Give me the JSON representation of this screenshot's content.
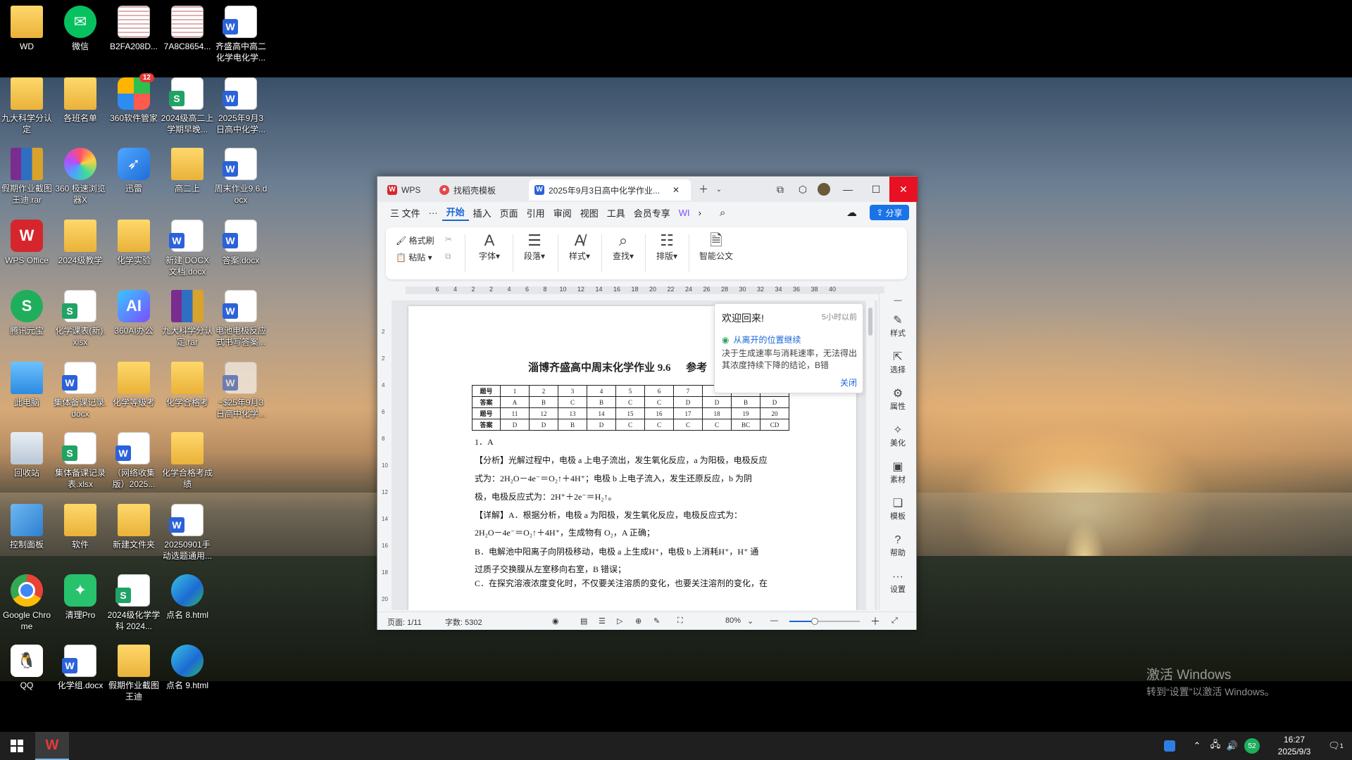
{
  "desktop": {
    "icons": [
      {
        "label": "WD"
      },
      {
        "label": "微信"
      },
      {
        "label": "B2FA208D..."
      },
      {
        "label": "7A8C8654..."
      },
      {
        "label": "齐盛高中高二化学电化学..."
      },
      {
        "label": "九大科学分认定"
      },
      {
        "label": "各班名单"
      },
      {
        "label": "360软件管家"
      },
      {
        "label": "2024级高二上学期早晚..."
      },
      {
        "label": "2025年9月3日高中化学..."
      },
      {
        "label": "假期作业截图王迪.rar"
      },
      {
        "label": "360 极速浏览器X"
      },
      {
        "label": "迅雷"
      },
      {
        "label": "高二上"
      },
      {
        "label": "周末作业9.6.docx"
      },
      {
        "label": "WPS Office"
      },
      {
        "label": "2024级教学"
      },
      {
        "label": "化学实验"
      },
      {
        "label": "新建 DOCX 文档.docx"
      },
      {
        "label": "答案.docx"
      },
      {
        "label": "腾讯元宝"
      },
      {
        "label": "化学课表(新).xlsx"
      },
      {
        "label": "360AI办公"
      },
      {
        "label": "九大科学分认定.rar"
      },
      {
        "label": "电池电极反应式书写答案..."
      },
      {
        "label": "此电脑"
      },
      {
        "label": "集体备课记录.docx"
      },
      {
        "label": "化学等级考"
      },
      {
        "label": "化学合格考"
      },
      {
        "label": "~$25年9月3日高中化学..."
      },
      {
        "label": "回收站"
      },
      {
        "label": "集体备课记录表.xlsx"
      },
      {
        "label": "（网络收集版）2025..."
      },
      {
        "label": "化学合格考成绩"
      },
      {
        "label": "控制面板"
      },
      {
        "label": "软件"
      },
      {
        "label": "新建文件夹"
      },
      {
        "label": "20250901手动选题通用..."
      },
      {
        "label": "Google Chrome"
      },
      {
        "label": "清理Pro"
      },
      {
        "label": "2024级化学学科 2024..."
      },
      {
        "label": "点名 8.html"
      },
      {
        "label": "QQ"
      },
      {
        "label": "化学组.docx"
      },
      {
        "label": "假期作业截图王迪"
      },
      {
        "label": "点名 9.html"
      }
    ],
    "badge_360": "12",
    "watermark_title": "激活 Windows",
    "watermark_sub": "转到“设置”以激活 Windows。"
  },
  "wps": {
    "tabs": [
      {
        "label": "WPS"
      },
      {
        "label": "找稻壳模板"
      },
      {
        "label": "2025年9月3日高中化学作业..."
      }
    ],
    "menu": [
      "三 文件",
      "···",
      "开始",
      "插入",
      "页面",
      "引用",
      "审阅",
      "视图",
      "工具",
      "会员专享",
      "WI"
    ],
    "share_label": "分享",
    "ribbon": {
      "format_painter": "格式刷",
      "paste": "粘贴",
      "font": "字体",
      "paragraph": "段落",
      "style": "样式",
      "find": "查找",
      "layout": "排版",
      "smart_doc": "智能公文"
    },
    "ruler_numbers": [
      "6",
      "4",
      "2",
      "2",
      "4",
      "6",
      "8",
      "10",
      "12",
      "14",
      "16",
      "18",
      "20",
      "22",
      "24",
      "26",
      "28",
      "30",
      "32",
      "34",
      "36",
      "38",
      "40"
    ],
    "vruler_numbers": [
      "2",
      "2",
      "4",
      "6",
      "8",
      "10",
      "12",
      "14",
      "16",
      "18",
      "20"
    ],
    "document": {
      "title": "淄博齐盛高中周末化学作业  9.6",
      "title_suffix": "参考",
      "table": [
        [
          "题号",
          "1",
          "2",
          "3",
          "4",
          "5",
          "6",
          "7",
          "8",
          "9",
          "10"
        ],
        [
          "答案",
          "A",
          "B",
          "C",
          "B",
          "C",
          "C",
          "D",
          "D",
          "B",
          "D"
        ],
        [
          "题号",
          "11",
          "12",
          "13",
          "14",
          "15",
          "16",
          "17",
          "18",
          "19",
          "20"
        ],
        [
          "答案",
          "D",
          "D",
          "B",
          "D",
          "C",
          "C",
          "C",
          "C",
          "BC",
          "CD"
        ]
      ],
      "lines": [
        "1．A",
        "【分析】光解过程中，电极 a 上电子流出，发生氧化反应，a 为阳极，电极反应",
        "式为：2H₂O－4e⁻＝O₂↑＋4H⁺；电极 b 上电子流入，发生还原反应，b 为阴",
        "极，电极反应式为：2H⁺＋2e⁻＝H₂↑。",
        "【详解】A．根据分析，电极 a 为阳极，发生氧化反应，电极反应式为：",
        "2H₂O－4e⁻＝O₂↑＋4H⁺，生成物有 O₂，A 正确；",
        "B．电解池中阳离子向阴极移动，电极 a 上生成H⁺，电极 b 上消耗H⁺，H⁺ 通",
        "过质子交换膜从左室移向右室，B 错误；",
        "C．在探究溶液浓度变化时，不仅要关注溶质的变化，也要关注溶剂的变化，在"
      ]
    },
    "popup": {
      "title": "欢迎回来!",
      "time": "5小时以前",
      "link": "从离开的位置继续",
      "text": "决于生成速率与消耗速率，无法得出其浓度持续下降的结论，B错",
      "close": "关闭"
    },
    "right_panel": [
      "样式",
      "选择",
      "属性",
      "美化",
      "素材",
      "模板",
      "帮助",
      "设置"
    ],
    "status": {
      "page": "页面: 1/11",
      "words": "字数: 5302",
      "zoom": "80%",
      "zoom_fraction": 0.36
    }
  },
  "taskbar": {
    "time": "16:27",
    "date": "2025/9/3",
    "notifications": "1",
    "tray_badge": "52"
  }
}
